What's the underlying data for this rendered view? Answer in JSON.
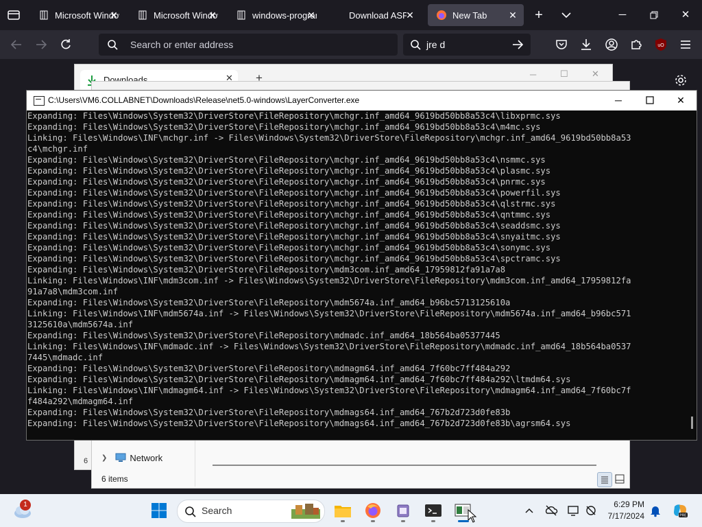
{
  "browser": {
    "tabs": [
      {
        "title": "Microsoft Windows",
        "active": false
      },
      {
        "title": "Microsoft Windows",
        "active": false
      },
      {
        "title": "windows-programming",
        "active": false
      },
      {
        "title": "Download ASP.NET",
        "active": false
      },
      {
        "title": "New Tab",
        "active": true
      }
    ],
    "urlbar_placeholder": "Search or enter address",
    "searchbar_value": "jre d"
  },
  "explorer": {
    "tab_title": "Downloads",
    "nav_network": "Network",
    "status_items": "6 items",
    "left_fragment": "6"
  },
  "console": {
    "title": "C:\\Users\\VM6.COLLABNET\\Downloads\\Release\\net5.0-windows\\LayerConverter.exe",
    "lines": [
      "Expanding: Files\\Windows\\System32\\DriverStore\\FileRepository\\mchgr.inf_amd64_9619bd50bb8a53c4\\libxprmc.sys",
      "Expanding: Files\\Windows\\System32\\DriverStore\\FileRepository\\mchgr.inf_amd64_9619bd50bb8a53c4\\m4mc.sys",
      "Linking: Files\\Windows\\INF\\mchgr.inf -> Files\\Windows\\System32\\DriverStore\\FileRepository\\mchgr.inf_amd64_9619bd50bb8a53",
      "c4\\mchgr.inf",
      "Expanding: Files\\Windows\\System32\\DriverStore\\FileRepository\\mchgr.inf_amd64_9619bd50bb8a53c4\\nsmmc.sys",
      "Expanding: Files\\Windows\\System32\\DriverStore\\FileRepository\\mchgr.inf_amd64_9619bd50bb8a53c4\\plasmc.sys",
      "Expanding: Files\\Windows\\System32\\DriverStore\\FileRepository\\mchgr.inf_amd64_9619bd50bb8a53c4\\pnrmc.sys",
      "Expanding: Files\\Windows\\System32\\DriverStore\\FileRepository\\mchgr.inf_amd64_9619bd50bb8a53c4\\powerfil.sys",
      "Expanding: Files\\Windows\\System32\\DriverStore\\FileRepository\\mchgr.inf_amd64_9619bd50bb8a53c4\\qlstrmc.sys",
      "Expanding: Files\\Windows\\System32\\DriverStore\\FileRepository\\mchgr.inf_amd64_9619bd50bb8a53c4\\qntmmc.sys",
      "Expanding: Files\\Windows\\System32\\DriverStore\\FileRepository\\mchgr.inf_amd64_9619bd50bb8a53c4\\seaddsmc.sys",
      "Expanding: Files\\Windows\\System32\\DriverStore\\FileRepository\\mchgr.inf_amd64_9619bd50bb8a53c4\\snyaitmc.sys",
      "Expanding: Files\\Windows\\System32\\DriverStore\\FileRepository\\mchgr.inf_amd64_9619bd50bb8a53c4\\sonymc.sys",
      "Expanding: Files\\Windows\\System32\\DriverStore\\FileRepository\\mchgr.inf_amd64_9619bd50bb8a53c4\\spctramc.sys",
      "Expanding: Files\\Windows\\System32\\DriverStore\\FileRepository\\mdm3com.inf_amd64_17959812fa91a7a8",
      "Linking: Files\\Windows\\INF\\mdm3com.inf -> Files\\Windows\\System32\\DriverStore\\FileRepository\\mdm3com.inf_amd64_17959812fa",
      "91a7a8\\mdm3com.inf",
      "Expanding: Files\\Windows\\System32\\DriverStore\\FileRepository\\mdm5674a.inf_amd64_b96bc5713125610a",
      "Linking: Files\\Windows\\INF\\mdm5674a.inf -> Files\\Windows\\System32\\DriverStore\\FileRepository\\mdm5674a.inf_amd64_b96bc571",
      "3125610a\\mdm5674a.inf",
      "Expanding: Files\\Windows\\System32\\DriverStore\\FileRepository\\mdmadc.inf_amd64_18b564ba05377445",
      "Linking: Files\\Windows\\INF\\mdmadc.inf -> Files\\Windows\\System32\\DriverStore\\FileRepository\\mdmadc.inf_amd64_18b564ba0537",
      "7445\\mdmadc.inf",
      "Expanding: Files\\Windows\\System32\\DriverStore\\FileRepository\\mdmagm64.inf_amd64_7f60bc7ff484a292",
      "Expanding: Files\\Windows\\System32\\DriverStore\\FileRepository\\mdmagm64.inf_amd64_7f60bc7ff484a292\\ltmdm64.sys",
      "Linking: Files\\Windows\\INF\\mdmagm64.inf -> Files\\Windows\\System32\\DriverStore\\FileRepository\\mdmagm64.inf_amd64_7f60bc7f",
      "f484a292\\mdmagm64.inf",
      "Expanding: Files\\Windows\\System32\\DriverStore\\FileRepository\\mdmags64.inf_amd64_767b2d723d0fe83b",
      "Expanding: Files\\Windows\\System32\\DriverStore\\FileRepository\\mdmags64.inf_amd64_767b2d723d0fe83b\\agrsm64.sys"
    ]
  },
  "taskbar": {
    "search_label": "Search",
    "time": "6:29 PM",
    "date": "7/17/2024",
    "weather_badge": "1"
  },
  "colors": {
    "browser_bg": "#1c1b22",
    "console_bg": "#0c0c0c",
    "console_text": "#cccccc",
    "taskbar_bg": "#ecf1f7",
    "accent_blue": "#0067c0"
  }
}
